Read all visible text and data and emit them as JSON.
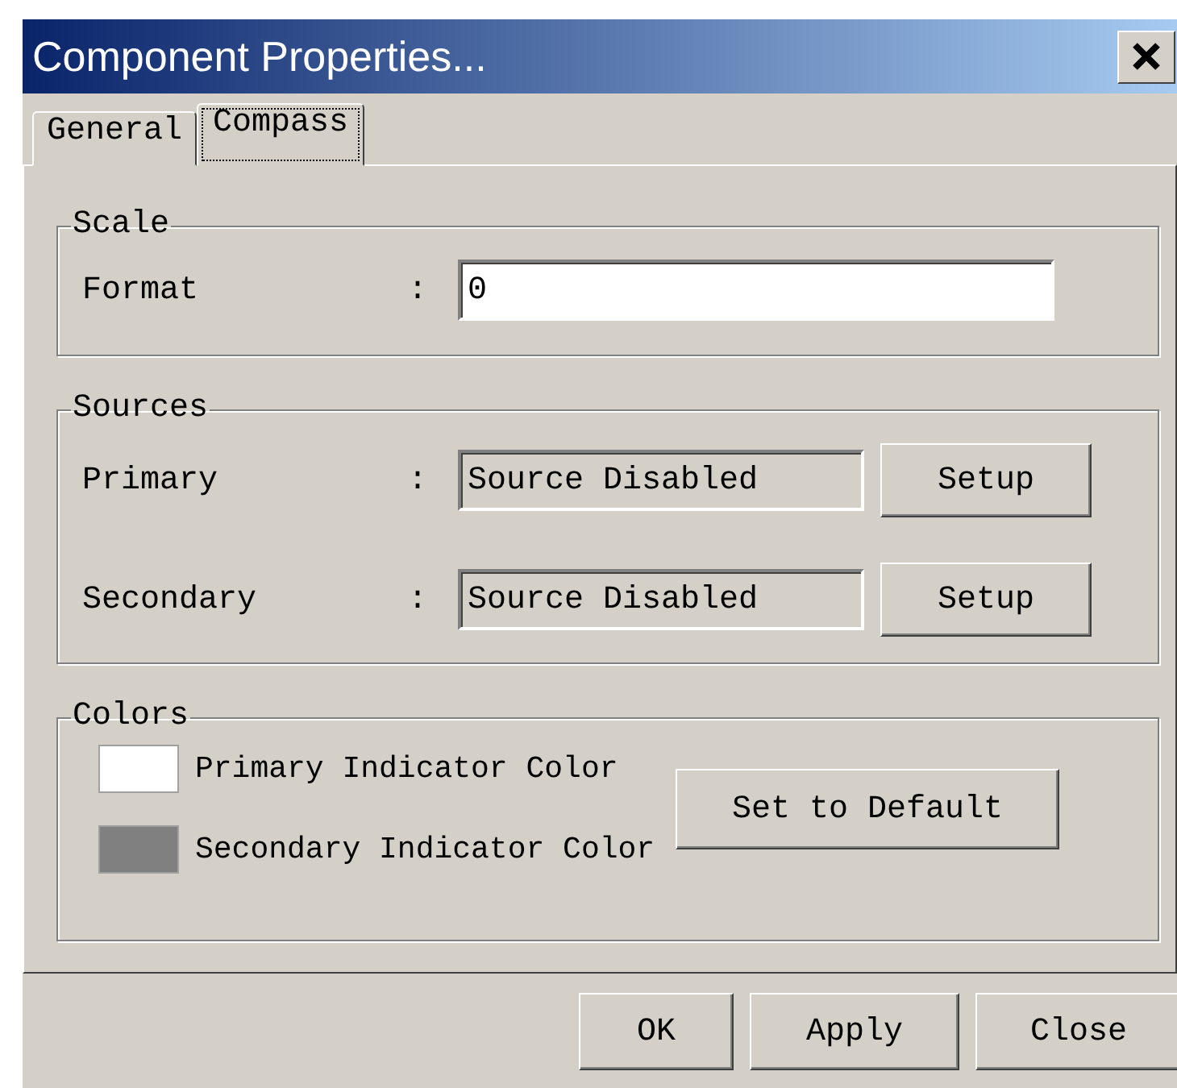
{
  "window": {
    "title": "Component Properties..."
  },
  "tabs": [
    {
      "label": "General",
      "selected": false
    },
    {
      "label": "Compass",
      "selected": true
    }
  ],
  "scale": {
    "legend": "Scale",
    "label": "Format",
    "separator": ":",
    "value": "0"
  },
  "sources": {
    "legend": "Sources",
    "rows": [
      {
        "label": "Primary",
        "separator": ":",
        "value": "Source Disabled",
        "button": "Setup"
      },
      {
        "label": "Secondary",
        "separator": ":",
        "value": "Source Disabled",
        "button": "Setup"
      }
    ]
  },
  "colors": {
    "legend": "Colors",
    "items": [
      {
        "label": "Primary Indicator Color",
        "color": "#ffffff"
      },
      {
        "label": "Secondary Indicator Color",
        "color": "#808080"
      }
    ],
    "button": "Set to Default"
  },
  "buttons": [
    "OK",
    "Apply",
    "Close"
  ]
}
